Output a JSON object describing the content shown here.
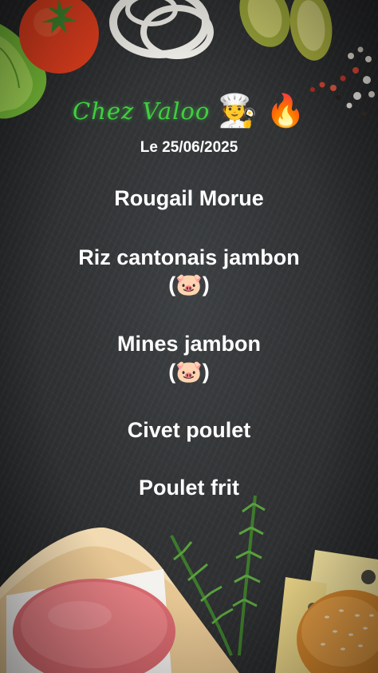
{
  "header": {
    "brand_name": "Chez Valoo",
    "chef_emoji": "🧑‍🍳",
    "fire_emoji": "🔥",
    "date": "Le 25/06/2025"
  },
  "menu": {
    "items": [
      {
        "name": "Rougail Morue"
      },
      {
        "name": "Riz cantonais jambon",
        "tag": "(🐷)"
      },
      {
        "name": "Mines jambon",
        "tag": "(🐷)"
      },
      {
        "name": "Civet poulet"
      },
      {
        "name": "Poulet frit"
      }
    ]
  },
  "colors": {
    "brand_green": "#3fcf3f",
    "text": "#ffffff",
    "board": "#303234"
  }
}
